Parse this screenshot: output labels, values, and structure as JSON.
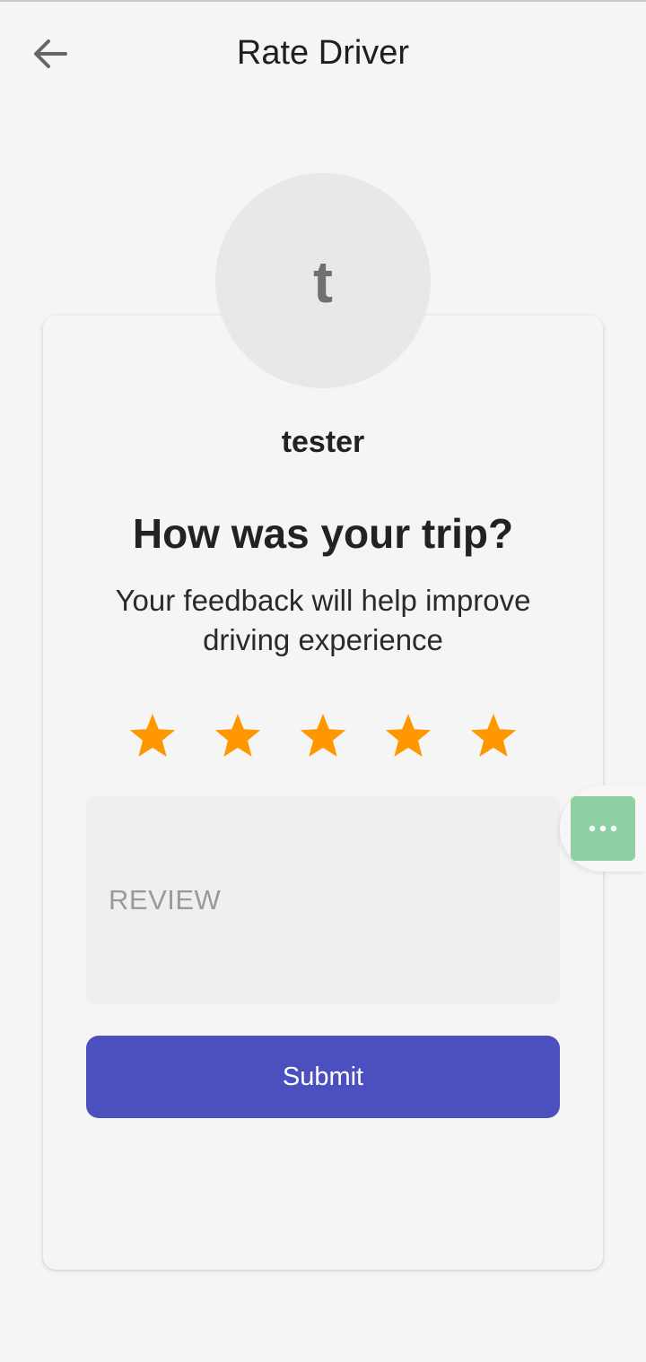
{
  "header": {
    "back_icon": "arrow-left-icon",
    "title": "Rate Driver"
  },
  "driver": {
    "avatar_letter": "t",
    "name": "tester"
  },
  "rating": {
    "question": "How was your trip?",
    "subtitle": "Your feedback will help improve driving experience",
    "stars": [
      {
        "icon": "star-icon",
        "filled": true
      },
      {
        "icon": "star-icon",
        "filled": true
      },
      {
        "icon": "star-icon",
        "filled": true
      },
      {
        "icon": "star-icon",
        "filled": true
      },
      {
        "icon": "star-icon",
        "filled": true
      }
    ],
    "value": 5,
    "max": 5
  },
  "review": {
    "placeholder": "REVIEW",
    "value": ""
  },
  "submit": {
    "label": "Submit"
  },
  "floating_menu": {
    "icon": "more-horizontal-icon"
  },
  "colors": {
    "background": "#f5f5f5",
    "star": "#ff9800",
    "submit_button": "#4b50be",
    "float_button": "#8fd0a3",
    "avatar_bg": "#e8e8e8"
  }
}
